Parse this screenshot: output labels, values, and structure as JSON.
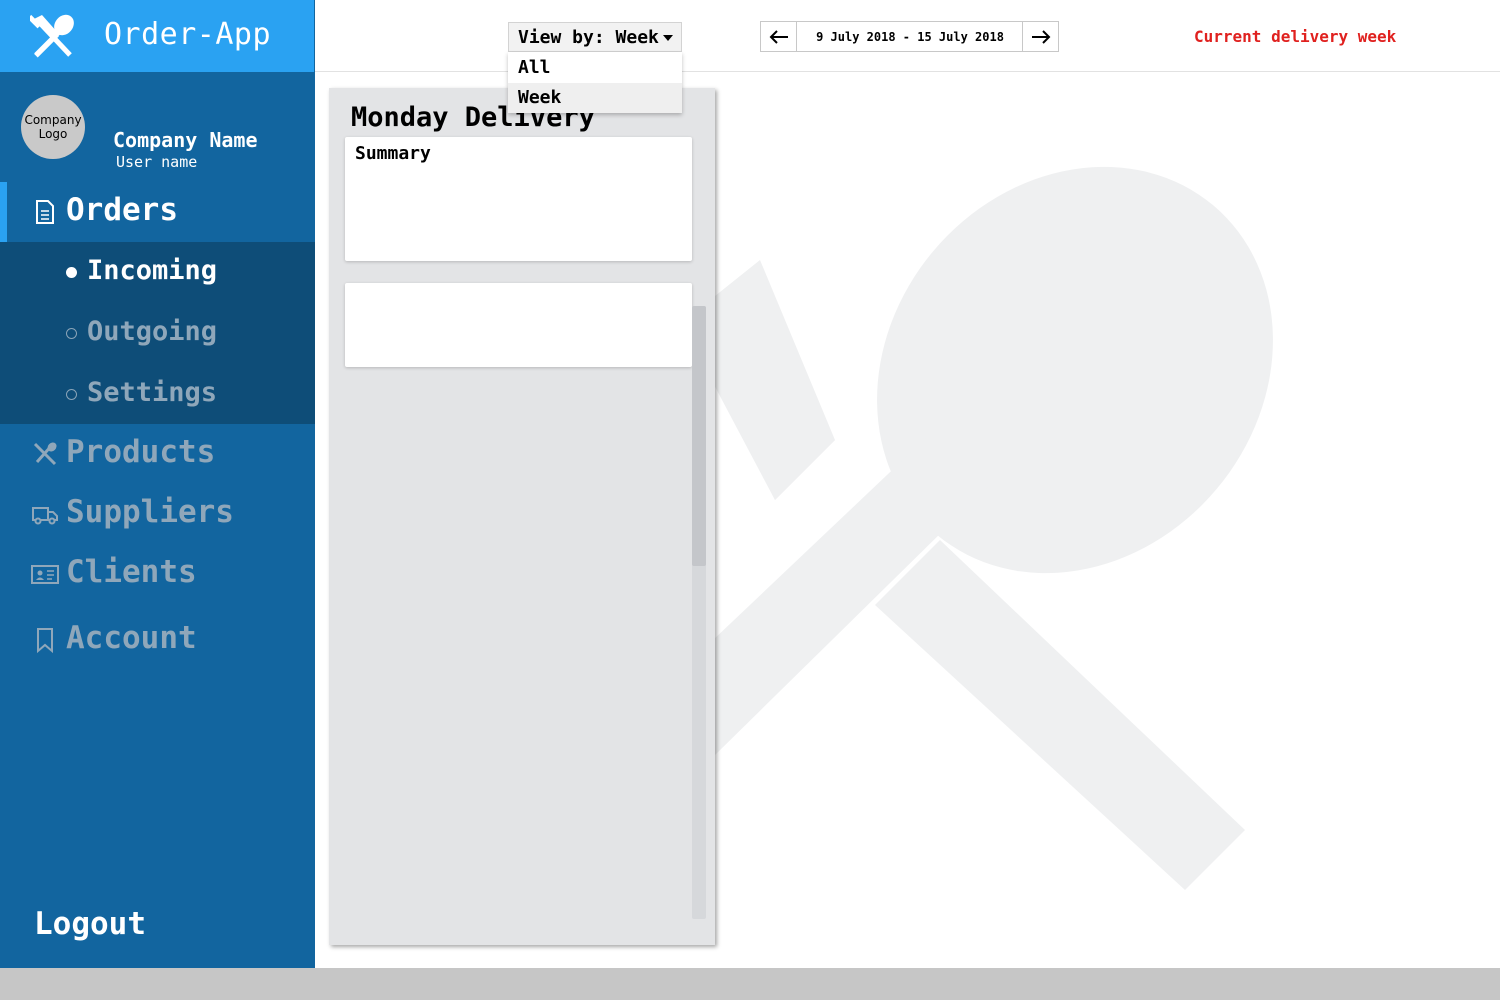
{
  "app": {
    "title": "Order-App"
  },
  "profile": {
    "logo_text_line1": "Company",
    "logo_text_line2": "Logo",
    "company_name": "Company Name",
    "user_name": "User name"
  },
  "nav": {
    "orders": "Orders",
    "sub_items": [
      {
        "label": "Incoming",
        "active": true
      },
      {
        "label": "Outgoing",
        "active": false
      },
      {
        "label": "Settings",
        "active": false
      }
    ],
    "products": "Products",
    "suppliers": "Suppliers",
    "clients": "Clients",
    "account": "Account",
    "logout": "Logout"
  },
  "toolbar": {
    "view_by_label": "View by: Week",
    "view_options": [
      "All",
      "Week"
    ],
    "selected_option": "Week",
    "date_range": "9 July 2018 - 15 July 2018",
    "current_week_label": "Current delivery week"
  },
  "panel": {
    "title": "Monday Delivery",
    "summary_title": "Summary"
  },
  "colors": {
    "brand_blue": "#2aa2f2",
    "sidebar_blue": "#12659f",
    "submenu_blue": "#0e4d78",
    "alert_red": "#e0211f"
  }
}
